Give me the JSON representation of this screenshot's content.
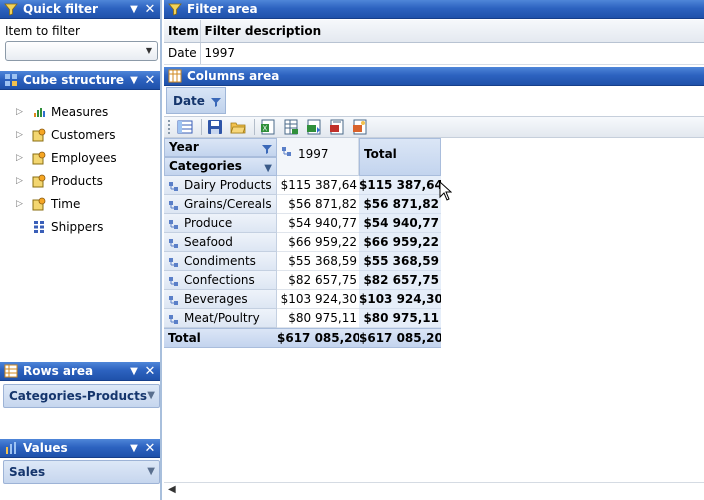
{
  "quick_filter": {
    "title": "Quick filter",
    "item_label": "Item to filter",
    "select_value": ""
  },
  "cube_structure": {
    "title": "Cube structure",
    "items": [
      {
        "label": "Measures",
        "icon": "measures-icon"
      },
      {
        "label": "Customers",
        "icon": "dimension-icon"
      },
      {
        "label": "Employees",
        "icon": "dimension-icon"
      },
      {
        "label": "Products",
        "icon": "dimension-icon"
      },
      {
        "label": "Time",
        "icon": "dimension-icon"
      },
      {
        "label": "Shippers",
        "icon": "grid-icon"
      }
    ]
  },
  "rows_area": {
    "title": "Rows area",
    "value": "Categories-Products"
  },
  "values_area": {
    "title": "Values",
    "value": "Sales"
  },
  "filter_area": {
    "title": "Filter area",
    "headers": {
      "item": "Item",
      "description": "Filter description"
    },
    "rows": [
      {
        "item": "Date",
        "description": "1997"
      }
    ]
  },
  "columns_area": {
    "title": "Columns area",
    "chip": "Date"
  },
  "toolbar": {
    "buttons": [
      "layout-icon",
      "save-icon",
      "open-folder-icon",
      "export-excel-icon",
      "export-grid-icon",
      "export-csv-icon",
      "export-pdf-icon",
      "export-image-icon"
    ]
  },
  "pivot": {
    "year_label": "Year",
    "categories_label": "Categories",
    "col_year": "1997",
    "col_total": "Total",
    "rows": [
      {
        "label": "Dairy Products",
        "value": "$115 387,64",
        "total": "$115 387,64"
      },
      {
        "label": "Grains/Cereals",
        "value": "$56 871,82",
        "total": "$56 871,82"
      },
      {
        "label": "Produce",
        "value": "$54 940,77",
        "total": "$54 940,77"
      },
      {
        "label": "Seafood",
        "value": "$66 959,22",
        "total": "$66 959,22"
      },
      {
        "label": "Condiments",
        "value": "$55 368,59",
        "total": "$55 368,59"
      },
      {
        "label": "Confections",
        "value": "$82 657,75",
        "total": "$82 657,75"
      },
      {
        "label": "Beverages",
        "value": "$103 924,30",
        "total": "$103 924,30"
      },
      {
        "label": "Meat/Poultry",
        "value": "$80 975,11",
        "total": "$80 975,11"
      }
    ],
    "total_label": "Total",
    "grand_value": "$617 085,20",
    "grand_total": "$617 085,20"
  },
  "colors": {
    "titlebar": "#2d63c0",
    "header_blue": "#c3d4ee",
    "accent": "#15356c"
  }
}
